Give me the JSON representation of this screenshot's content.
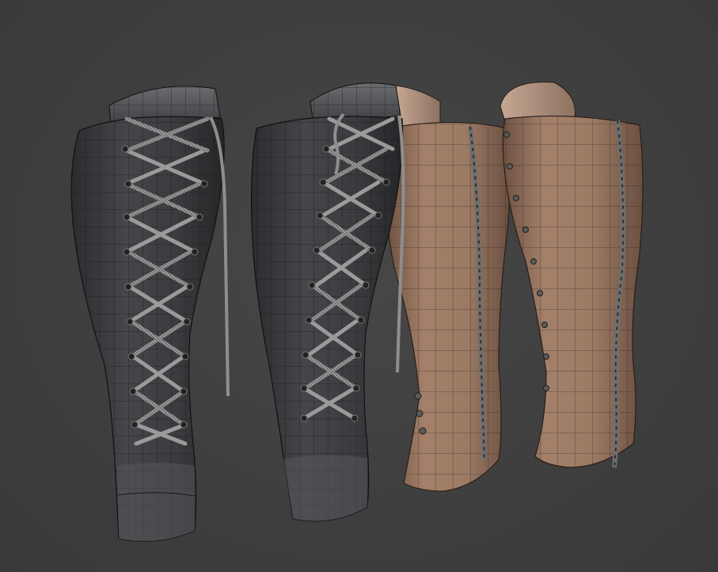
{
  "scene": {
    "background_color": "#3f3f3f",
    "dark_leather_color": "#3a3b3d",
    "brown_leather_color": "#9a7a63",
    "wire_color": "#1a1a1a",
    "lace_color": "#8a8a8a",
    "objects": [
      {
        "kind": "laced-boot-shaft",
        "material": "dark-leather",
        "view": "front-laced",
        "wireframe": true
      },
      {
        "kind": "laced-boot-shaft",
        "material": "dark-leather",
        "view": "front-laced",
        "wireframe": true
      },
      {
        "kind": "boot-shaft",
        "material": "brown-leather",
        "view": "side-stitched",
        "wireframe": true
      },
      {
        "kind": "boot-shaft",
        "material": "brown-leather",
        "view": "back-stitched",
        "wireframe": true
      }
    ]
  }
}
